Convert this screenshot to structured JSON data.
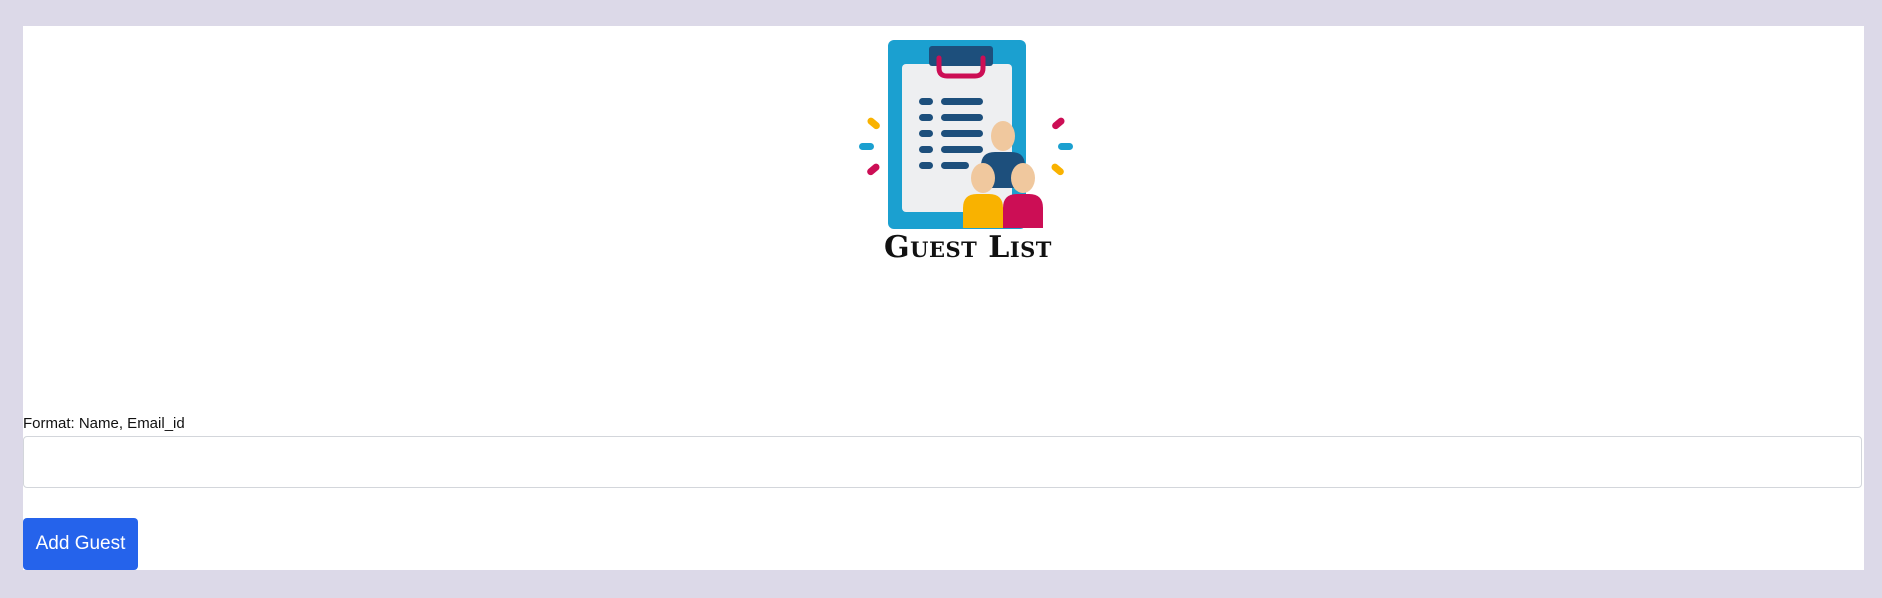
{
  "logo": {
    "text": "Guest List",
    "icon": "clipboard-guests-icon"
  },
  "form": {
    "format_label": "Format: Name, Email_id",
    "input_value": "",
    "input_placeholder": "",
    "add_button_label": "Add Guest"
  },
  "colors": {
    "page_background": "#dcd9e8",
    "card_background": "#ffffff",
    "button_background": "#2563eb",
    "clipboard_blue": "#1ba0d0",
    "clip_navy": "#1d4f7c",
    "accent_pink": "#cc0e55",
    "accent_yellow": "#f9b200"
  }
}
